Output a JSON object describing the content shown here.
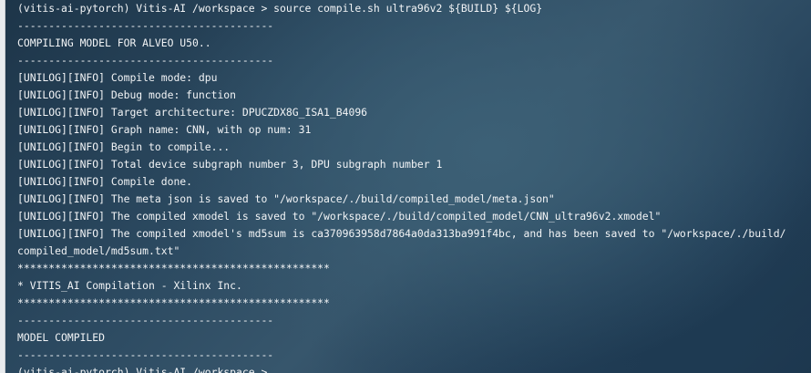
{
  "terminal": {
    "lines": [
      "(vitis-ai-pytorch) Vitis-AI /workspace > source compile.sh ultra96v2 ${BUILD} ${LOG}",
      "-----------------------------------------",
      "COMPILING MODEL FOR ALVEO U50..",
      "-----------------------------------------",
      "[UNILOG][INFO] Compile mode: dpu",
      "[UNILOG][INFO] Debug mode: function",
      "[UNILOG][INFO] Target architecture: DPUCZDX8G_ISA1_B4096",
      "[UNILOG][INFO] Graph name: CNN, with op num: 31",
      "[UNILOG][INFO] Begin to compile...",
      "[UNILOG][INFO] Total device subgraph number 3, DPU subgraph number 1",
      "[UNILOG][INFO] Compile done.",
      "[UNILOG][INFO] The meta json is saved to \"/workspace/./build/compiled_model/meta.json\"",
      "[UNILOG][INFO] The compiled xmodel is saved to \"/workspace/./build/compiled_model/CNN_ultra96v2.xmodel\"",
      "[UNILOG][INFO] The compiled xmodel's md5sum is ca370963958d7864a0da313ba991f4bc, and has been saved to \"/workspace/./build/",
      "compiled_model/md5sum.txt\"",
      "**************************************************",
      "* VITIS_AI Compilation - Xilinx Inc.",
      "**************************************************",
      "-----------------------------------------",
      "MODEL COMPILED",
      "-----------------------------------------",
      "(vitis-ai-pytorch) Vitis-AI /workspace >"
    ]
  }
}
